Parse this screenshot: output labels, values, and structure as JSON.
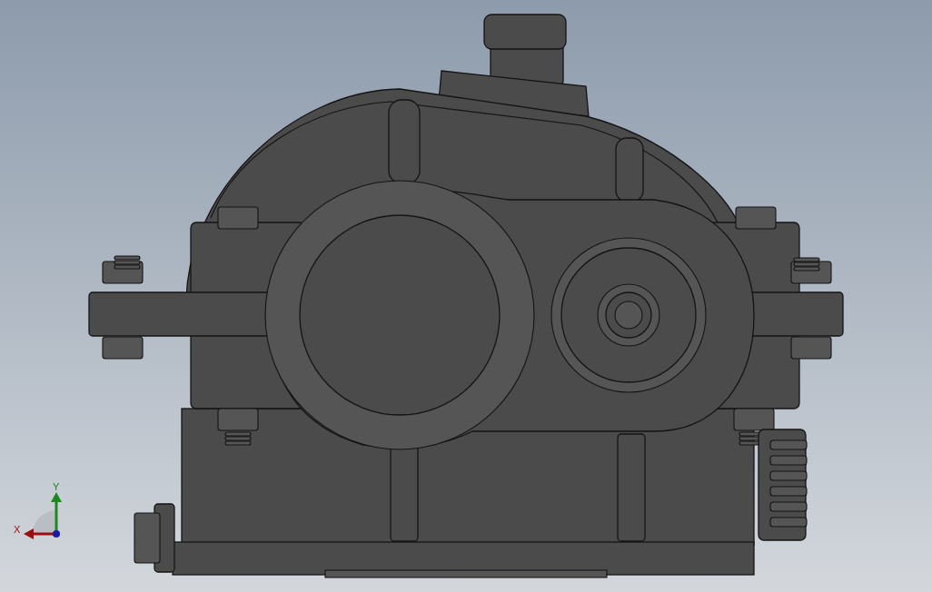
{
  "viewport": {
    "model": {
      "kind": "gearbox"
    },
    "triad": {
      "x_label": "X",
      "y_label": "Y"
    }
  }
}
